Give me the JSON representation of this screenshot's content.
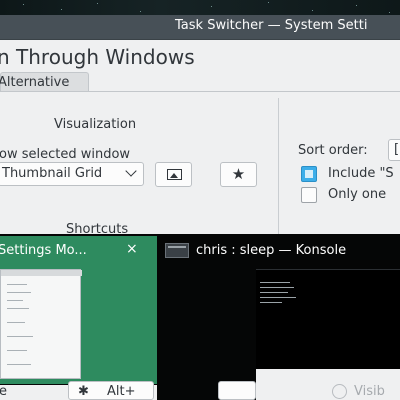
{
  "window": {
    "title": "Task Switcher — System Setti"
  },
  "page": {
    "title": "n Through Windows"
  },
  "tabs": [
    {
      "label": "Alternative"
    }
  ],
  "visualization": {
    "heading": "Visualization",
    "show_selected_label": "ow selected window",
    "layout_value": "Thumbnail Grid"
  },
  "shortcuts": {
    "heading": "Shortcuts",
    "shortcut_value": "Alt+",
    "first_label_fragment": "e"
  },
  "sort": {
    "label": "Sort order:",
    "value_fragment": "[",
    "include_label": "Include \"S",
    "include_checked": true,
    "only_one_label": "Only one",
    "only_one_checked": false,
    "visible_fragment": "Visib"
  },
  "switcher": {
    "items": [
      {
        "title": "Settings Mo...",
        "close_label": "×",
        "selected": true,
        "icon": "settings-window-icon"
      },
      {
        "title": "chris : sleep — Konsole",
        "selected": false,
        "icon": "konsole-icon"
      }
    ]
  },
  "colors": {
    "titlebar": "#475057",
    "window_bg": "#eff0f1",
    "selected_item": "#2e8b5f",
    "accent": "#3daee9",
    "switcher_bg": "#050606"
  }
}
